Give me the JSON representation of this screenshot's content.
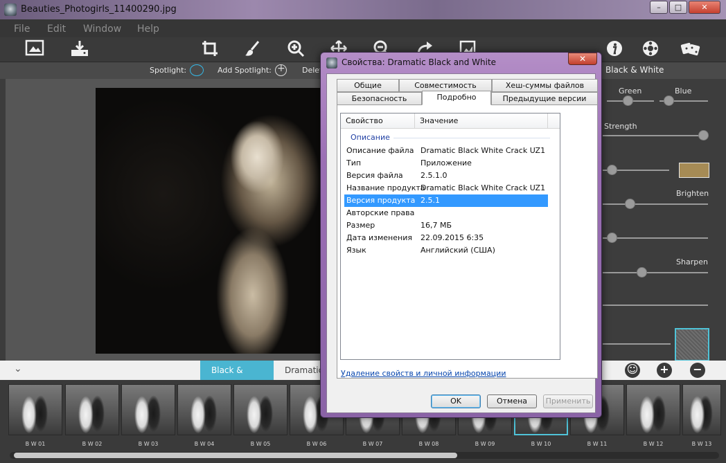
{
  "window": {
    "title": "Beauties_Photogirls_11400290.jpg",
    "min": "–",
    "max": "□",
    "close": "✕"
  },
  "menu": {
    "file": "File",
    "edit": "Edit",
    "window": "Window",
    "help": "Help"
  },
  "toolbar": {
    "icons": [
      "open-image-icon",
      "save-download-icon",
      "crop-icon",
      "brush-icon",
      "zoom-in-icon",
      "move-icon",
      "zoom-out-icon",
      "redo-icon",
      "fit-image-icon",
      "info-icon",
      "settings-wheel-icon",
      "dice-icon"
    ]
  },
  "subtoolbar": {
    "spotlight_label": "Spotlight:",
    "add_spotlight_label": "Add Spotlight:",
    "delete_label": "Delet"
  },
  "panel": {
    "header": "Black & White",
    "green_label": "Green",
    "blue_label": "Blue",
    "strength_label": "Strength",
    "brighten_label": "Brighten",
    "sharpen_label": "Sharpen",
    "tone_color": "#a68b55"
  },
  "presetbar": {
    "active_tab": "Black & White",
    "next_tab": "Dramatic"
  },
  "filmstrip": {
    "labels": [
      "B W 01",
      "B W 02",
      "B W 03",
      "B W 04",
      "B W 05",
      "B W 06",
      "B W 07",
      "B W 08",
      "B W 09",
      "B W 10",
      "B W 11",
      "B W 12",
      "B W 13"
    ],
    "selected_index": 9
  },
  "dialog": {
    "title": "Свойства: Dramatic Black and White",
    "tabs_row1": [
      "Общие",
      "Совместимость",
      "Хеш-суммы файлов"
    ],
    "tabs_row2": [
      "Безопасность",
      "Подробно",
      "Предыдущие версии"
    ],
    "active_tab": "Подробно",
    "table": {
      "col_property": "Свойство",
      "col_value": "Значение",
      "group": "Описание",
      "rows": [
        {
          "k": "Описание файла",
          "v": "Dramatic Black White Crack UZ1"
        },
        {
          "k": "Тип",
          "v": "Приложение"
        },
        {
          "k": "Версия файла",
          "v": "2.5.1.0"
        },
        {
          "k": "Название продукта",
          "v": "Dramatic Black White Crack UZ1"
        },
        {
          "k": "Версия продукта",
          "v": "2.5.1"
        },
        {
          "k": "Авторские права",
          "v": ""
        },
        {
          "k": "Размер",
          "v": "16,7 МБ"
        },
        {
          "k": "Дата изменения",
          "v": "22.09.2015 6:35"
        },
        {
          "k": "Язык",
          "v": "Английский (США)"
        }
      ],
      "selected_row": 4
    },
    "link": "Удаление свойств и личной информации",
    "ok": "OK",
    "cancel": "Отмена",
    "apply": "Применить"
  }
}
